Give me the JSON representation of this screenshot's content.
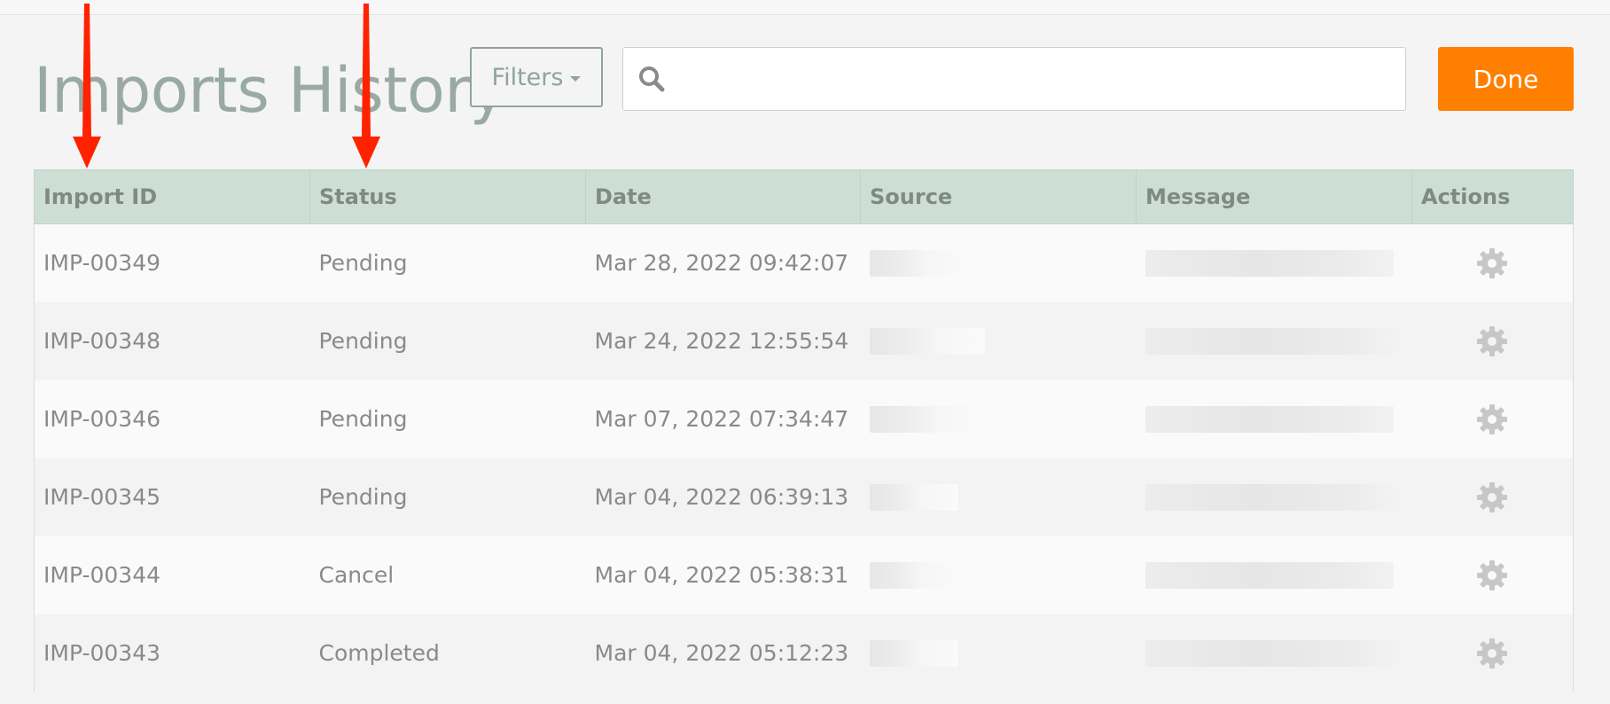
{
  "page": {
    "title": "Imports History"
  },
  "toolbar": {
    "filters_label": "Filters",
    "search_placeholder": "",
    "done_label": "Done"
  },
  "table": {
    "headers": [
      "Import ID",
      "Status",
      "Date",
      "Source",
      "Message",
      "Actions"
    ],
    "rows": [
      {
        "id": "IMP-00349",
        "status": "Pending",
        "date": "Mar 28, 2022 09:42:07"
      },
      {
        "id": "IMP-00348",
        "status": "Pending",
        "date": "Mar 24, 2022 12:55:54"
      },
      {
        "id": "IMP-00346",
        "status": "Pending",
        "date": "Mar 07, 2022 07:34:47"
      },
      {
        "id": "IMP-00345",
        "status": "Pending",
        "date": "Mar 04, 2022 06:39:13"
      },
      {
        "id": "IMP-00344",
        "status": "Cancel",
        "date": "Mar 04, 2022 05:38:31"
      },
      {
        "id": "IMP-00343",
        "status": "Completed",
        "date": "Mar 04, 2022 05:12:23"
      }
    ]
  },
  "colors": {
    "accent": "#ff7f00",
    "header_bg": "#cddfd5",
    "title": "#98aaa1",
    "annotation_arrow": "#ff2200"
  },
  "icons": {
    "search": "search-icon",
    "actions": "gear-icon",
    "filter_caret": "caret-down-icon"
  }
}
